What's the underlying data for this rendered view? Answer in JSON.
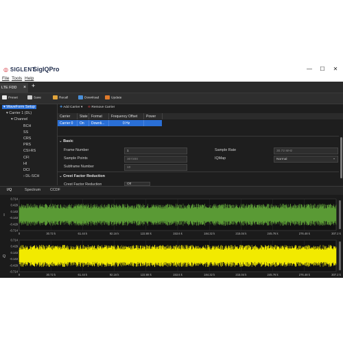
{
  "titlebar": {
    "brand": "SIGLENT",
    "product": "SigIQPro",
    "minimize": "—",
    "maximize": "☐",
    "close": "✕"
  },
  "menubar": {
    "items": [
      "File",
      "Tools",
      "Help"
    ]
  },
  "tabs": {
    "active": "LTE FDD",
    "close": "×",
    "add": "+"
  },
  "toolbar": {
    "preset": "Preset",
    "save": "Save",
    "recall": "Recall",
    "download": "Download",
    "update": "Update"
  },
  "tree": {
    "items": [
      {
        "label": "WaveForm Setup",
        "depth": 0,
        "arrow": "▾",
        "selected": true
      },
      {
        "label": "Carrier 1 (DL)",
        "depth": 1,
        "arrow": "▾"
      },
      {
        "label": "Channel",
        "depth": 2,
        "arrow": "▾"
      },
      {
        "label": "BCH",
        "depth": 3
      },
      {
        "label": "SS",
        "depth": 3
      },
      {
        "label": "CRS",
        "depth": 3
      },
      {
        "label": "PRS",
        "depth": 3
      },
      {
        "label": "CSI-RS",
        "depth": 3
      },
      {
        "label": "CFI",
        "depth": 3
      },
      {
        "label": "HI",
        "depth": 3
      },
      {
        "label": "DCI",
        "depth": 3
      },
      {
        "label": "DL-SCH",
        "depth": 3,
        "arrow": "›"
      }
    ]
  },
  "carrier_toolbar": {
    "add": "Add Carrier",
    "add_arrow": "▾",
    "remove": "Remove Carrier"
  },
  "carrier_table": {
    "headers": [
      "Carrier",
      "State",
      "Format",
      "Frequency Offset",
      "Power"
    ],
    "row": [
      "Carrier 0",
      "On",
      "Downli...",
      "0 Hz",
      ""
    ]
  },
  "basic": {
    "title": "Basic",
    "frame_number_label": "Frame Number",
    "frame_number": "1",
    "sample_points_label": "Sample Points",
    "sample_points": "307200",
    "subframe_number_label": "Subframe Number",
    "subframe_number": "10",
    "sample_rate_label": "Sample Rate",
    "sample_rate": "30.72 MHz",
    "iqmap_label": "IQMap",
    "iqmap": "Normal"
  },
  "cfr": {
    "title": "Crest Factor Reduction",
    "partial_label": "Crest Factor Reduction",
    "partial_value": "Off"
  },
  "bottom_tabs": [
    "I/Q",
    "Spectrum",
    "CCDF"
  ],
  "colors": {
    "accent": "#2a6fd6",
    "i_trace": "#5a9a35",
    "q_trace": "#f2ea00",
    "panel": "#1e1e1e"
  },
  "chart_data": [
    {
      "type": "line",
      "ylabel": "I",
      "x_ticks": [
        "0",
        "30.72 k",
        "61.44 k",
        "92.16 k",
        "122.88 k",
        "153.6 k",
        "184.32 k",
        "215.04 k",
        "245.76 k",
        "276.48 k",
        "307.2 k"
      ],
      "y_ticks": [
        "0.714",
        "0.429",
        "0.143",
        "-0.143",
        "-0.429",
        "-0.714"
      ],
      "xlim": [
        0,
        307200
      ],
      "ylim": [
        -0.714,
        0.714
      ],
      "envelope_approx": 0.5
    },
    {
      "type": "line",
      "ylabel": "Q",
      "x_ticks": [
        "0",
        "30.72 k",
        "61.44 k",
        "92.16 k",
        "122.88 k",
        "153.6 k",
        "184.32 k",
        "215.04 k",
        "245.76 k",
        "276.48 k",
        "307.2 k"
      ],
      "y_ticks": [
        "0.714",
        "0.429",
        "0.143",
        "-0.143",
        "-0.429",
        "-0.714"
      ],
      "xlim": [
        0,
        307200
      ],
      "ylim": [
        -0.714,
        0.714
      ],
      "envelope_approx": 0.5
    }
  ]
}
